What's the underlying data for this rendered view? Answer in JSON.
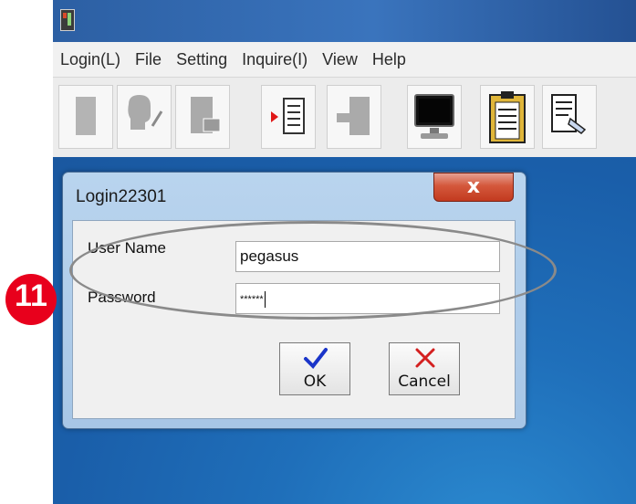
{
  "menu": [
    "Login(L)",
    "File",
    "Setting",
    "Inquire(I)",
    "View",
    "Help"
  ],
  "toolbar": {
    "buttons": [
      "disabled-login-icon",
      "disabled-user-icon",
      "disabled-document-icon",
      "export-icon",
      "disabled-folder-icon",
      "monitor-icon",
      "clipboard-icon",
      "report-edit-icon"
    ]
  },
  "dialog": {
    "title": "Login22301",
    "close_label": "x",
    "username_label": "User Name",
    "username_value": "pegasus",
    "password_label": "Password",
    "password_value": "******",
    "ok_label": "OK",
    "cancel_label": "Cancel"
  },
  "annotation": {
    "step_number": "11"
  },
  "colors": {
    "desktop_blue": "#1f6fba",
    "close_red": "#c23a1f",
    "badge_red": "#e8001c",
    "ok_check": "#1a35c9",
    "cancel_x": "#d42020"
  }
}
